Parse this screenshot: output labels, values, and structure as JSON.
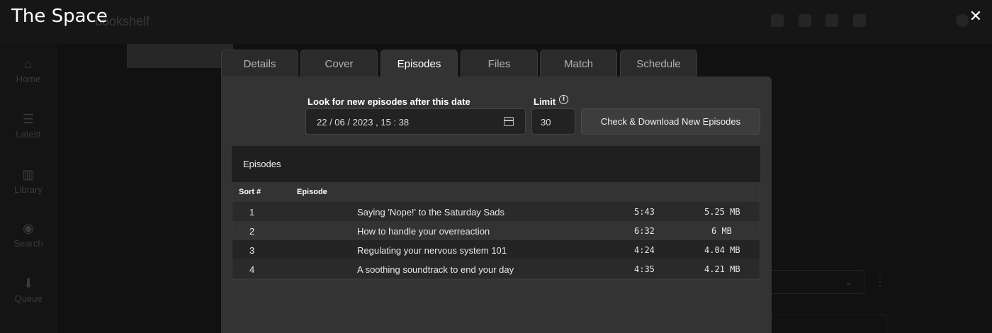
{
  "modal": {
    "title": "The Space"
  },
  "tabs": [
    "Details",
    "Cover",
    "Episodes",
    "Files",
    "Match",
    "Schedule"
  ],
  "active_tab": "Episodes",
  "form": {
    "date_label": "Look for new episodes after this date",
    "date_value": "22 / 06 / 2023 ,  15 : 38",
    "limit_label": "Limit",
    "limit_value": "30",
    "check_button": "Check & Download New Episodes"
  },
  "episodes": {
    "heading": "Episodes",
    "columns": {
      "sort": "Sort #",
      "episode": "Episode"
    },
    "rows": [
      {
        "sort": "1",
        "title": "Saying 'Nope!' to the Saturday Sads",
        "duration": "5:43",
        "size": "5.25 MB"
      },
      {
        "sort": "2",
        "title": "How to handle your overreaction",
        "duration": "6:32",
        "size": "6 MB"
      },
      {
        "sort": "3",
        "title": "Regulating your nervous system 101",
        "duration": "4:24",
        "size": "4.04 MB"
      },
      {
        "sort": "4",
        "title": "A soothing soundtrack to end your day",
        "duration": "4:35",
        "size": "4.21 MB"
      }
    ]
  },
  "background": {
    "app_title": "bookshelf",
    "sidebar": [
      "Home",
      "Latest",
      "Library",
      "Search",
      "Queue"
    ]
  },
  "colors": {
    "panel": "#333333",
    "row_alt": "#2a2a2a",
    "row_dark": "#232323",
    "overlay": "#000000"
  }
}
